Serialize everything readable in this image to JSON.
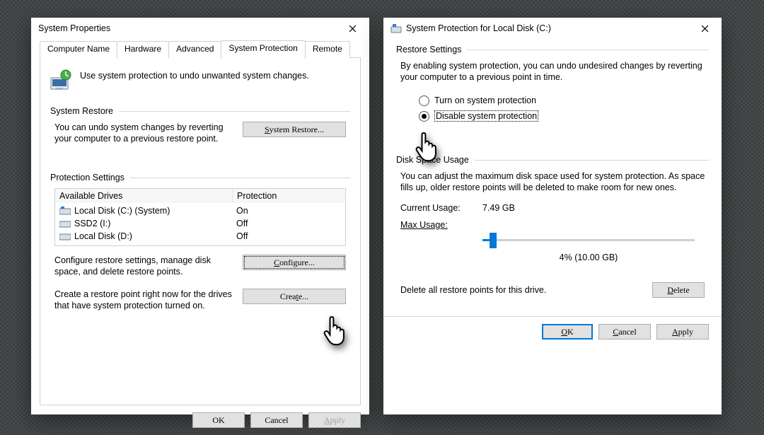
{
  "w1": {
    "title": "System Properties",
    "tabs": [
      "Computer Name",
      "Hardware",
      "Advanced",
      "System Protection",
      "Remote"
    ],
    "activeTab": 3,
    "heroText": "Use system protection to undo unwanted system changes.",
    "restore": {
      "title": "System Restore",
      "desc": "You can undo system changes by reverting your computer to a previous restore point.",
      "button": "System Restore..."
    },
    "prot": {
      "title": "Protection Settings",
      "col1": "Available Drives",
      "col2": "Protection",
      "drives": [
        {
          "name": "Local Disk (C:) (System)",
          "state": "On"
        },
        {
          "name": "SSD2 (I:)",
          "state": "Off"
        },
        {
          "name": "Local Disk (D:)",
          "state": "Off"
        }
      ],
      "configDesc": "Configure restore settings, manage disk space, and delete restore points.",
      "configBtn": "Configure...",
      "createDesc": "Create a restore point right now for the drives that have system protection turned on.",
      "createBtn": "Create..."
    },
    "buttons": {
      "ok": "OK",
      "cancel": "Cancel",
      "apply": "Apply"
    }
  },
  "w2": {
    "title": "System Protection for Local Disk (C:)",
    "restore": {
      "title": "Restore Settings",
      "desc": "By enabling system protection, you can undo undesired changes by reverting your computer to a previous point in time.",
      "opt1": "Turn on system protection",
      "opt2": "Disable system protection",
      "selected": 1
    },
    "disk": {
      "title": "Disk Space Usage",
      "desc": "You can adjust the maximum disk space used for system protection. As space fills up, older restore points will be deleted to make room for new ones.",
      "curLabel": "Current Usage:",
      "curVal": "7.49 GB",
      "maxLabel": "Max Usage:",
      "sliderLabel": "4% (10.00 GB)"
    },
    "del": {
      "desc": "Delete all restore points for this drive.",
      "btn": "Delete"
    },
    "buttons": {
      "ok": "OK",
      "cancel": "Cancel",
      "apply": "Apply"
    }
  }
}
